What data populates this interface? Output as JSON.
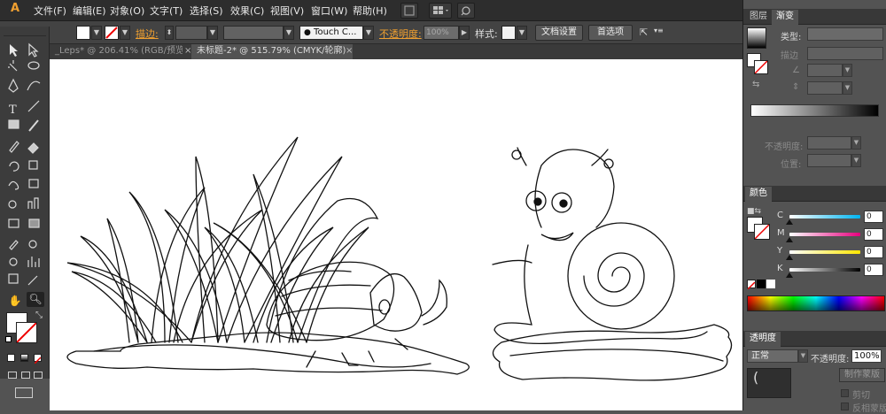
{
  "menubar": {
    "items": [
      "文件(F)",
      "编辑(E)",
      "对象(O)",
      "文字(T)",
      "选择(S)",
      "效果(C)",
      "视图(V)",
      "窗口(W)",
      "帮助(H)"
    ]
  },
  "controlbar": {
    "stroke_label": "描边:",
    "brush_name": "Touch C...",
    "opacity_label": "不透明度:",
    "opacity_value": "100%",
    "style_label": "样式:",
    "doc_settings_button": "文档设置",
    "preferences_button": "首选项"
  },
  "doc_tabs": [
    {
      "label": "_Leps* @ 206.41% (RGB/预览)",
      "active": false
    },
    {
      "label": "未标题-2* @ 515.79% (CMYK/轮廓)",
      "active": true
    }
  ],
  "gradient_panel": {
    "tabs": [
      "图层",
      "渐变"
    ],
    "type_label": "类型:",
    "stroke_label": "描边",
    "opacity_label": "不透明度:",
    "location_label": "位置:"
  },
  "color_panel": {
    "title": "颜色",
    "channels": [
      {
        "name": "C",
        "value": "0",
        "color": "#00b4f0"
      },
      {
        "name": "M",
        "value": "0",
        "color": "#e6007e"
      },
      {
        "name": "Y",
        "value": "0",
        "color": "#ffe600"
      },
      {
        "name": "K",
        "value": "0",
        "color": "#000000"
      }
    ]
  },
  "transparency_panel": {
    "title": "透明度",
    "blend_mode": "正常",
    "opacity_label": "不透明度:",
    "opacity_value": "100%",
    "make_mask_button": "制作蒙版",
    "clip_label": "剪切",
    "invert_mask_label": "反相蒙版"
  },
  "colors": {
    "accent_orange": "#f0a030",
    "panel_bg": "#535353",
    "menubar_bg": "#2d2d2d"
  }
}
